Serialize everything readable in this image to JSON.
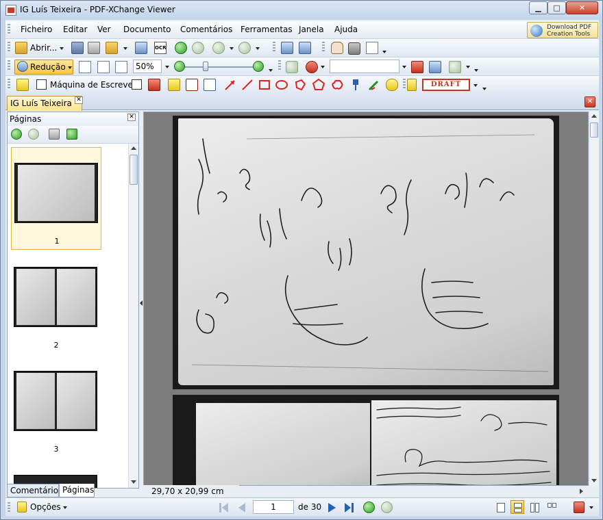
{
  "window": {
    "title": "IG Luís Teixeira  - PDF-XChange Viewer",
    "controls": {
      "minimize": "▁",
      "maximize": "□",
      "close": "✕"
    }
  },
  "menubar": {
    "items": [
      "Ficheiro",
      "Editar",
      "Ver",
      "Documento",
      "Comentários",
      "Ferramentas",
      "Janela",
      "Ajuda"
    ],
    "download_button": {
      "line1": "Download PDF",
      "line2": "Creation Tools"
    }
  },
  "toolbar1": {
    "open_label": "Abrir...",
    "ocr_label": "OCR"
  },
  "toolbar2": {
    "zoom_mode_label": "Redução",
    "zoom_value": "50%"
  },
  "toolbar3": {
    "typewriter_label": "Máquina de Escrever",
    "stamp_label": "DRAFT"
  },
  "document_tab": {
    "label": "IG Luís Teixeira",
    "close": "✕"
  },
  "pages_panel": {
    "title": "Páginas",
    "close": "✕",
    "thumbnails": [
      {
        "number": "1",
        "selected": true
      },
      {
        "number": "2",
        "selected": false
      },
      {
        "number": "3",
        "selected": false
      }
    ]
  },
  "panel_tabs": {
    "comments": "Comentários",
    "pages": "Páginas"
  },
  "page_size": "29,70 x 20,99 cm",
  "statusbar": {
    "options_label": "Opções",
    "current_page": "1",
    "total_pages": "de 30"
  },
  "colors": {
    "accent_yellow": "#f8c647",
    "chrome_blue": "#c7d6e8",
    "viewer_bg": "#7d7d7d"
  }
}
